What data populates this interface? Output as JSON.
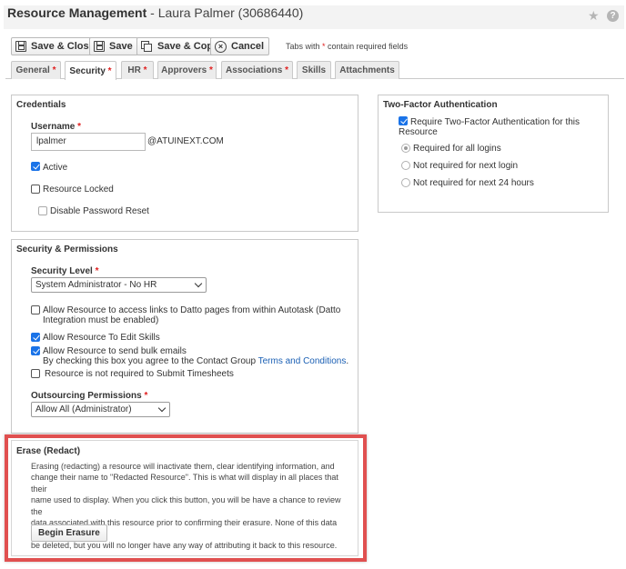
{
  "header": {
    "title": "Resource Management",
    "subtitle": " - Laura Palmer (30686440)",
    "star_icon": "star-icon",
    "help_icon": "help-icon",
    "help_glyph": "?"
  },
  "toolbar": {
    "save_close_label": "Save & Close",
    "save_label": "Save",
    "save_copy_label": "Save & Copy",
    "cancel_label": "Cancel",
    "hint_prefix": "Tabs with ",
    "hint_star": "*",
    "hint_suffix": " contain required fields"
  },
  "tabs": [
    {
      "label": "General",
      "required": "*"
    },
    {
      "label": "Security",
      "required": "*"
    },
    {
      "label": "HR",
      "required": "*"
    },
    {
      "label": "Approvers",
      "required": "*"
    },
    {
      "label": "Associations",
      "required": "*"
    },
    {
      "label": "Skills",
      "required": ""
    },
    {
      "label": "Attachments",
      "required": ""
    }
  ],
  "credentials": {
    "title": "Credentials",
    "username_label": "Username",
    "username_value": "lpalmer",
    "domain": "@ATUINEXT.COM",
    "active_label": "Active",
    "active_checked": true,
    "locked_label": "Resource Locked",
    "locked_checked": false,
    "disable_reset_label": "Disable Password Reset",
    "disable_reset_checked": false
  },
  "two_factor": {
    "title": "Two-Factor Authentication",
    "require_label_line1": "Require Two-Factor Authentication for this",
    "require_label_line2": "Resource",
    "require_checked": true,
    "options": [
      "Required for all logins",
      "Not required for next login",
      "Not required for next 24 hours"
    ],
    "selected_option": "Required for all logins"
  },
  "security": {
    "title": "Security & Permissions",
    "level_label": "Security Level",
    "level_value": "System Administrator - No HR",
    "datto_label_line1": "Allow Resource to access links to Datto pages from within Autotask (Datto",
    "datto_label_line2": "Integration must be enabled)",
    "datto_checked": false,
    "edit_skills_label": "Allow Resource To Edit Skills",
    "edit_skills_checked": true,
    "bulk_email_label": "Allow Resource to send bulk emails",
    "bulk_email_checked": true,
    "bulk_email_note_prefix": "By checking this box you agree to the Contact Group ",
    "bulk_email_link": "Terms and Conditions",
    "bulk_email_note_suffix": ".",
    "timesheets_label": "Resource is not required to Submit Timesheets",
    "timesheets_checked": false,
    "outsourcing_label": "Outsourcing Permissions",
    "outsourcing_value": "Allow All (Administrator)"
  },
  "erase": {
    "title": "Erase (Redact)",
    "lines": [
      "Erasing (redacting) a resource will inactivate them, clear identifying information, and",
      "change their name to \"Redacted Resource\". This is what will display in all places that their",
      "name used to display. When you click this button, you will be have a chance to review the",
      "data associated with this resource prior to confirming their erasure. None of this data will",
      "be deleted, but you will no longer have any way of attributing it back to this resource."
    ],
    "button_label": "Begin Erasure"
  },
  "colors": {
    "required": "#e02020",
    "checkbox_checked": "#1a73e8",
    "link": "#1a5fb4",
    "highlight": "#e05050"
  }
}
